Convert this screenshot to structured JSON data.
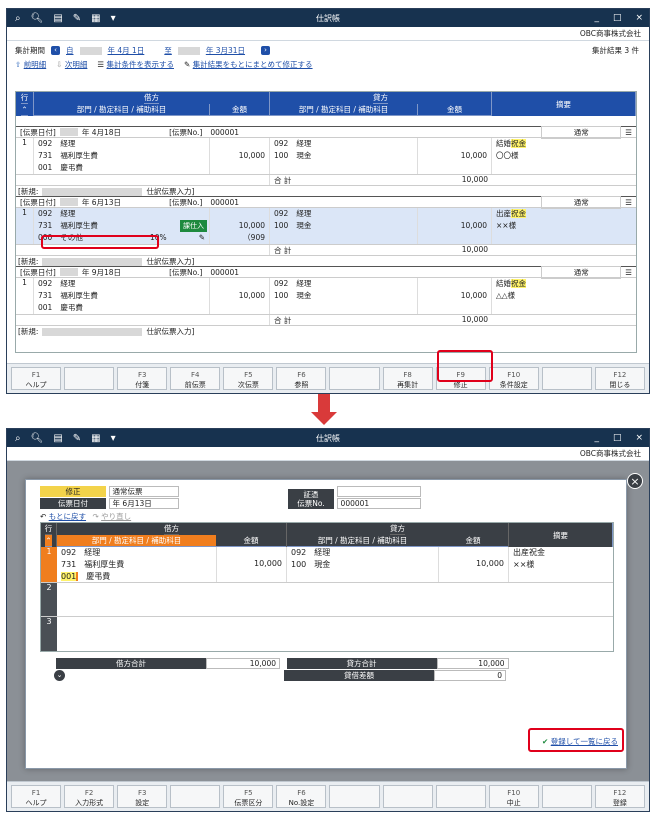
{
  "app": {
    "title": "仕訳帳",
    "company": "OBC商事株式会社",
    "titlebar_icons": [
      "search-plus-icon",
      "zoom-icon",
      "print-icon",
      "tool-icon",
      "excel-icon",
      "dropdown-icon"
    ],
    "controls": {
      "minimize": "_",
      "maximize": "□",
      "close": "×"
    }
  },
  "screen1": {
    "period_label": "集計期間",
    "from_prefix": "自",
    "from_date": "年  4月 1日",
    "to_prefix": "至",
    "to_date": "年  3月31日",
    "prev_detail": "前明細",
    "next_detail": "次明細",
    "show_conditions": "集計条件を表示する",
    "bulk_edit": "集計結果をもとにまとめて修正する",
    "result_count": "集計結果 3 件",
    "header": {
      "row": "行",
      "debit": "借方",
      "credit": "貸方",
      "dept_acct": "部門 / 勘定科目 / 補助科目",
      "amount": "金額",
      "memo": "摘要"
    },
    "entries": [
      {
        "date_label": "[伝票日付]",
        "date": "年  4月18日",
        "no_label": "[伝票No.]",
        "no": "000001",
        "type": "通常",
        "row": "1",
        "debit_lines": [
          [
            "092",
            "経理"
          ],
          [
            "731",
            "福利厚生費"
          ],
          [
            "001",
            "慶弔費"
          ]
        ],
        "debit_amount": "10,000",
        "credit_lines": [
          [
            "092",
            "経理"
          ],
          [
            "100",
            "現金"
          ]
        ],
        "credit_amount": "10,000",
        "memo_prefix": "結婚",
        "memo_hl": "祝金",
        "memo2": "〇〇様",
        "total_label": "合  計",
        "total": "10,000",
        "footer_label": "[新規:",
        "footer_text": "仕訳伝票入力]"
      },
      {
        "date_label": "[伝票日付]",
        "date": "年  6月13日",
        "no_label": "[伝票No.]",
        "no": "000001",
        "type": "通常",
        "row": "1",
        "debit_lines": [
          [
            "092",
            "経理"
          ],
          [
            "731",
            "福利厚生費"
          ],
          [
            "000",
            "その他"
          ]
        ],
        "tax_badge": "課仕入",
        "tax_rate": "10%",
        "tax_amount": "（909",
        "debit_amount": "10,000",
        "credit_lines": [
          [
            "092",
            "経理"
          ],
          [
            "100",
            "現金"
          ]
        ],
        "credit_amount": "10,000",
        "memo_prefix": "出産",
        "memo_hl": "祝金",
        "memo2": "××様",
        "total_label": "合  計",
        "total": "10,000",
        "footer_label": "[新規:",
        "footer_text": "仕訳伝票入力]"
      },
      {
        "date_label": "[伝票日付]",
        "date": "年  9月18日",
        "no_label": "[伝票No.]",
        "no": "000001",
        "type": "通常",
        "row": "1",
        "debit_lines": [
          [
            "092",
            "経理"
          ],
          [
            "731",
            "福利厚生費"
          ],
          [
            "001",
            "慶弔費"
          ]
        ],
        "debit_amount": "10,000",
        "credit_lines": [
          [
            "092",
            "経理"
          ],
          [
            "100",
            "現金"
          ]
        ],
        "credit_amount": "10,000",
        "memo_prefix": "結婚",
        "memo_hl": "祝金",
        "memo2": "△△様",
        "total_label": "合  計",
        "total": "10,000",
        "footer_label": "[新規:",
        "footer_text": "仕訳伝票入力]"
      }
    ],
    "fkeys": [
      {
        "num": "F1",
        "label": "ヘルプ"
      },
      {
        "num": "",
        "label": ""
      },
      {
        "num": "F3",
        "label": "付箋"
      },
      {
        "num": "F4",
        "label": "前伝票"
      },
      {
        "num": "F5",
        "label": "次伝票"
      },
      {
        "num": "F6",
        "label": "参照"
      },
      {
        "num": "",
        "label": ""
      },
      {
        "num": "F8",
        "label": "再集計"
      },
      {
        "num": "F9",
        "label": "修正"
      },
      {
        "num": "F10",
        "label": "条件設定"
      },
      {
        "num": "",
        "label": ""
      },
      {
        "num": "F12",
        "label": "閉じる"
      }
    ]
  },
  "screen2": {
    "mode": "修正",
    "slip_type": "通常伝票",
    "slip_date_label": "伝票日付",
    "slip_date": "年  6月13日",
    "voucher_label": "証憑",
    "voucher_no_label": "伝票No.",
    "voucher_no": "000001",
    "undo": "もとに戻す",
    "redo": "やり直し",
    "header": {
      "row": "行",
      "debit": "借方",
      "credit": "貸方",
      "dept_acct": "部門 / 勘定科目 / 補助科目",
      "amount": "金額",
      "memo": "摘要"
    },
    "rows": [
      "1",
      "2",
      "3"
    ],
    "debit_lines": [
      [
        "092",
        "経理"
      ],
      [
        "731",
        "福利厚生費"
      ],
      [
        "001",
        "慶弔費"
      ]
    ],
    "debit_amount": "10,000",
    "credit_lines": [
      [
        "092",
        "経理"
      ],
      [
        "100",
        "現金"
      ]
    ],
    "credit_amount": "10,000",
    "memo1": "出産祝金",
    "memo2": "××様",
    "debit_total_label": "借方合計",
    "debit_total": "10,000",
    "credit_total_label": "貸方合計",
    "credit_total": "10,000",
    "diff_label": "貸借差額",
    "diff": "0",
    "register_return": "登録して一覧に戻る",
    "fkeys": [
      {
        "num": "F1",
        "label": "ヘルプ"
      },
      {
        "num": "F2",
        "label": "入力形式"
      },
      {
        "num": "F3",
        "label": "設定"
      },
      {
        "num": "",
        "label": ""
      },
      {
        "num": "F5",
        "label": "伝票区分"
      },
      {
        "num": "F6",
        "label": "No.設定"
      },
      {
        "num": "",
        "label": ""
      },
      {
        "num": "",
        "label": ""
      },
      {
        "num": "",
        "label": ""
      },
      {
        "num": "F10",
        "label": "中止"
      },
      {
        "num": "",
        "label": ""
      },
      {
        "num": "F12",
        "label": "登録"
      }
    ]
  },
  "colors": {
    "titlebar": "#17324f",
    "header_blue": "#1f4fa8",
    "accent_orange": "#f07e1e",
    "highlight_red": "#e0001b",
    "tax_green": "#1e8a3e"
  }
}
